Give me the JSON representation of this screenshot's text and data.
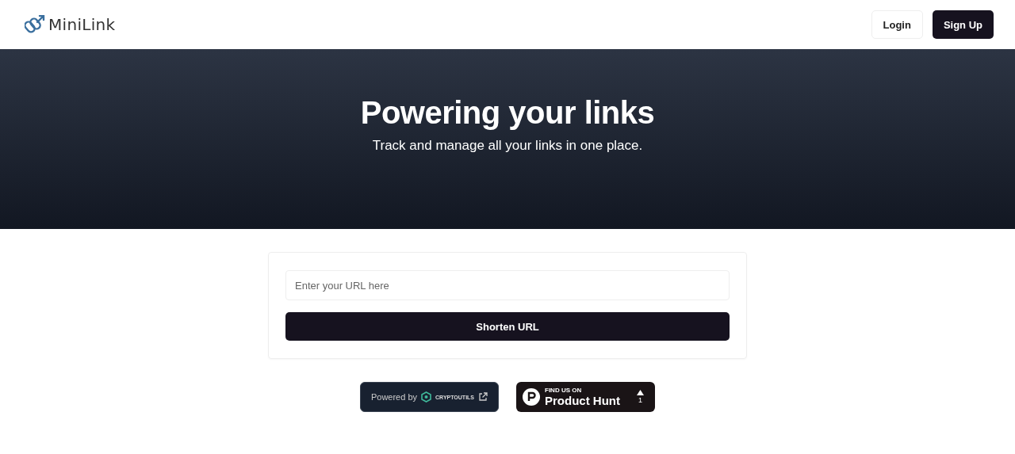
{
  "header": {
    "logo": "MiniLink",
    "buttons": [
      {
        "label": "Login",
        "kind": "outline"
      },
      {
        "label": "Sign Up",
        "kind": "solid"
      }
    ]
  },
  "hero": {
    "title": "Powering your links",
    "subtitle": "Track and manage all your links in one place."
  },
  "form": {
    "placeholder": "Enter your URL here",
    "button": "Shorten URL"
  },
  "badges": {
    "powered_by": "Powered by",
    "cryptoutils": "CRYPTOUTILS",
    "ph_small": "FIND US ON",
    "ph_name": "Product Hunt",
    "ph_votes": "1"
  }
}
